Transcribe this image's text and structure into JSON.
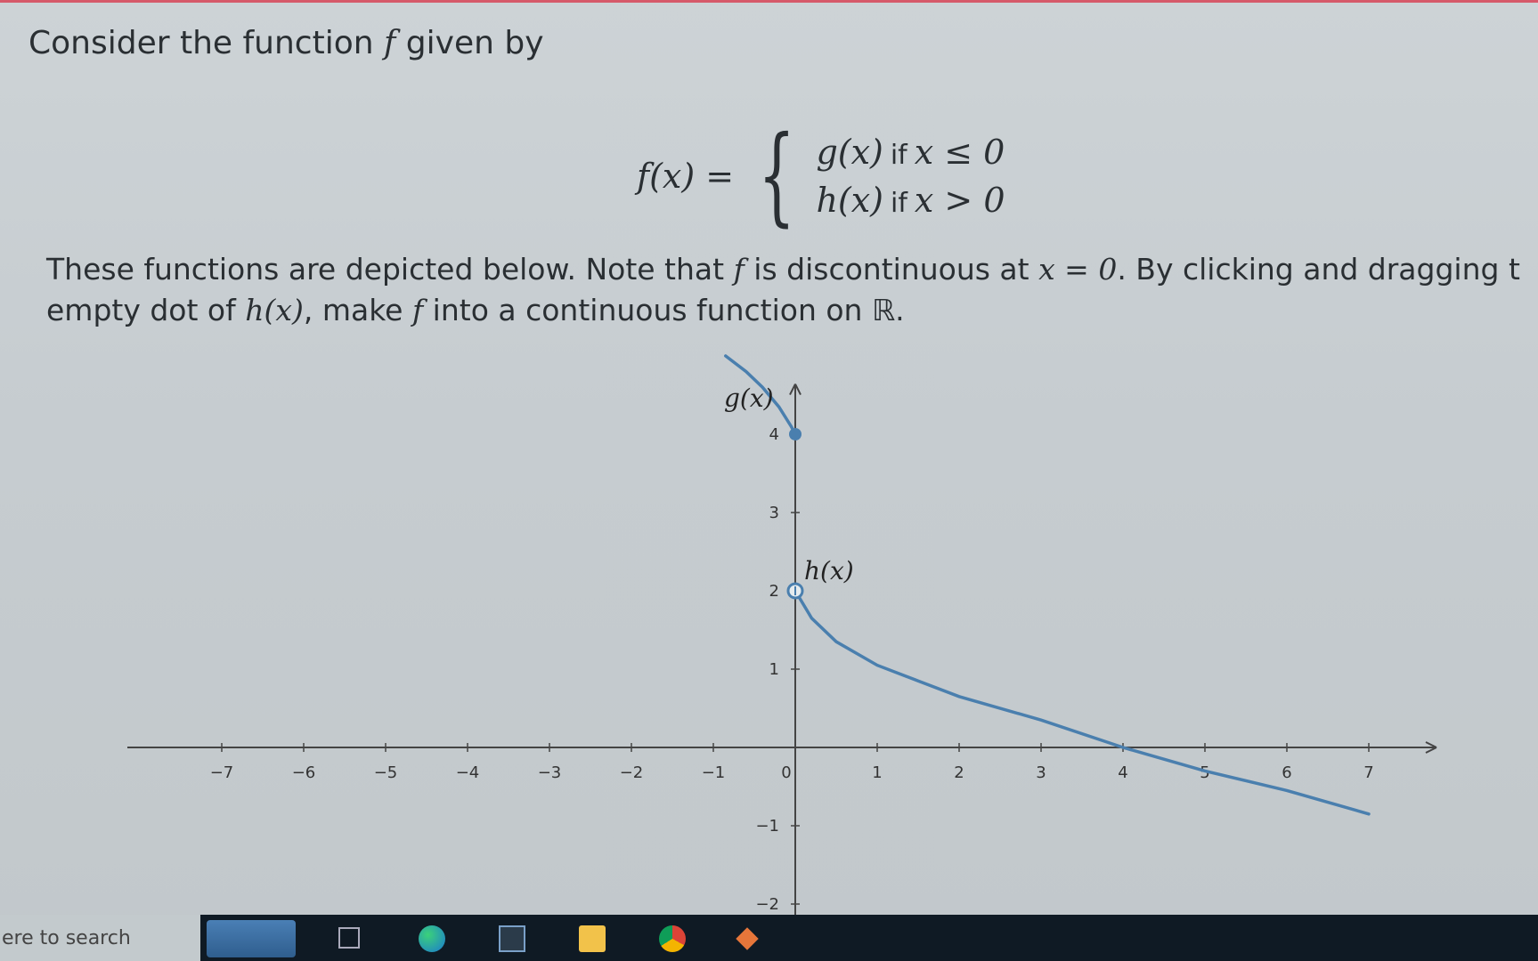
{
  "intro": {
    "prefix": "Consider the function",
    "fname": "f",
    "suffix": "given by"
  },
  "formula": {
    "lhs": "f(x) =",
    "case1_fn": "g(x)",
    "case1_if": "if",
    "case1_cond": "x ≤ 0",
    "case2_fn": "h(x)",
    "case2_if": "if",
    "case2_cond": "x > 0"
  },
  "description": {
    "line1_a": "These functions are depicted below. Note that",
    "line1_f": "f",
    "line1_b": "is discontinuous at",
    "line1_x": "x = 0",
    "line1_c": ". By clicking and dragging t",
    "line2_a": "empty dot of",
    "line2_h": "h(x)",
    "line2_b": ", make",
    "line2_f": "f",
    "line2_c": "into a continuous function on ℝ."
  },
  "chart_data": {
    "type": "line",
    "x_ticks": [
      "-7",
      "-6",
      "-5",
      "-4",
      "-3",
      "-2",
      "-1",
      "0",
      "1",
      "2",
      "3",
      "4",
      "5",
      "6",
      "7"
    ],
    "y_ticks": [
      "-2",
      "-1",
      "1",
      "2",
      "3",
      "4"
    ],
    "xlim": [
      -7.5,
      7.5
    ],
    "ylim": [
      -2.2,
      4.8
    ],
    "series": [
      {
        "name": "g(x)",
        "x": [
          -0.85,
          -0.6,
          -0.4,
          -0.2,
          -0.05,
          0
        ],
        "y": [
          5.0,
          4.8,
          4.6,
          4.35,
          4.1,
          4.0
        ],
        "endpoint": "filled",
        "endpoint_at": [
          0,
          4
        ]
      },
      {
        "name": "h(x)",
        "x": [
          0,
          0.2,
          0.5,
          1,
          1.5,
          2,
          3,
          4,
          5,
          6,
          7
        ],
        "y": [
          2,
          1.65,
          1.35,
          1.05,
          0.85,
          0.65,
          0.35,
          0.0,
          -0.3,
          -0.55,
          -0.85
        ],
        "endpoint": "empty",
        "endpoint_at": [
          0,
          2
        ]
      }
    ],
    "line_color": "#4a7fae"
  },
  "taskbar": {
    "search_text": "ere to search"
  }
}
